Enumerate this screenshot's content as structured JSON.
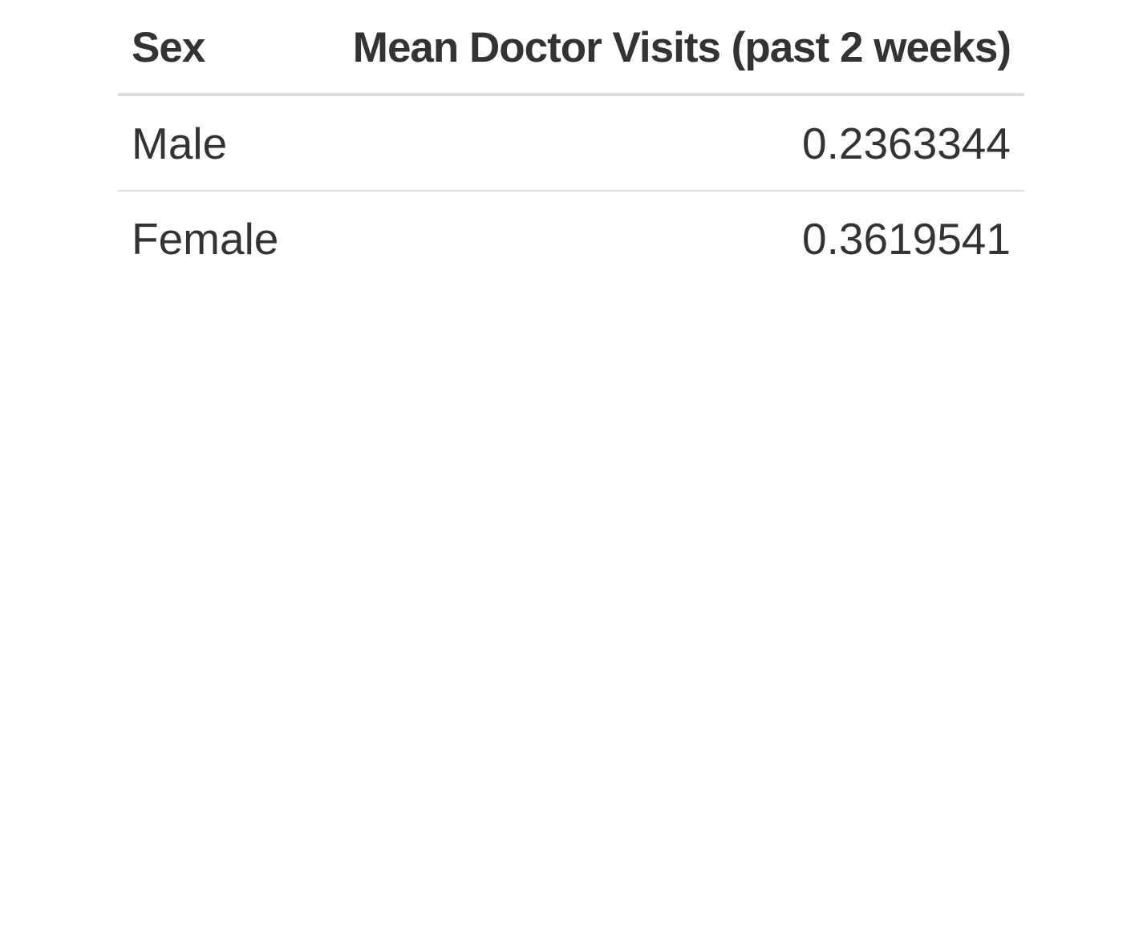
{
  "table": {
    "columns": [
      "Sex",
      "Mean Doctor Visits (past 2 weeks)"
    ],
    "rows": [
      {
        "sex": "Male",
        "mean_visits": "0.2363344"
      },
      {
        "sex": "Female",
        "mean_visits": "0.3619541"
      }
    ]
  },
  "colors": {
    "text": "#333333",
    "rule": "#dddddd",
    "background": "#ffffff"
  }
}
